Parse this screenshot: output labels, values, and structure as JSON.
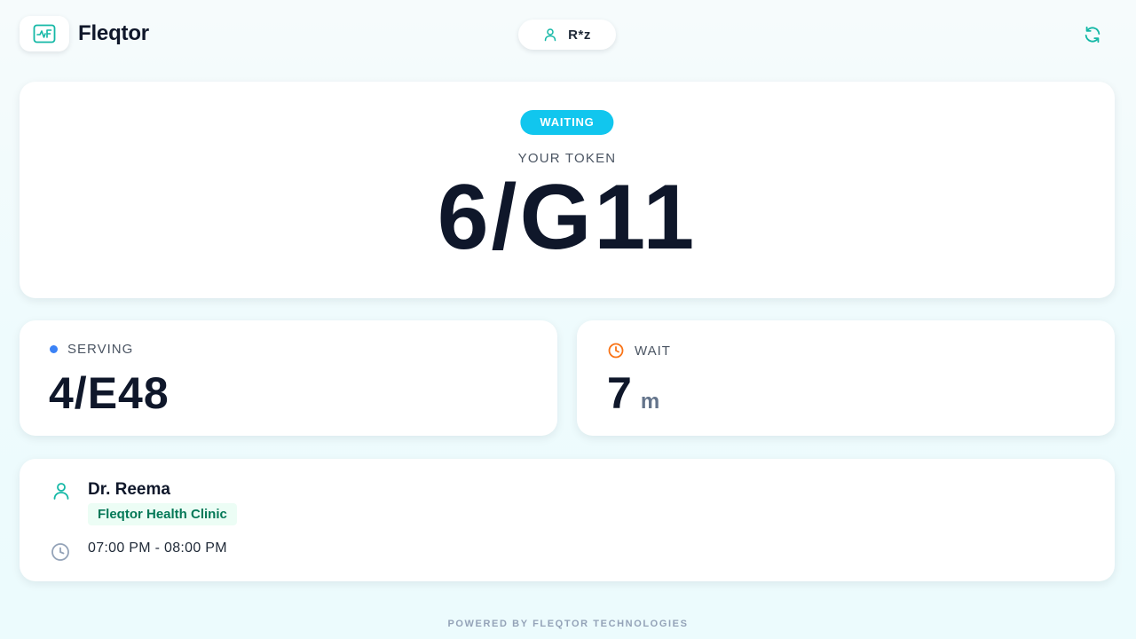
{
  "header": {
    "brand_name": "Fleqtor",
    "logo_icon": "heartbeat-monitor-icon",
    "user_icon": "user-icon",
    "user_name": "R*z",
    "refresh_icon": "refresh-icon"
  },
  "token": {
    "status": "WAITING",
    "label": "YOUR TOKEN",
    "value": "6/G11"
  },
  "serving": {
    "label": "SERVING",
    "value": "4/E48"
  },
  "wait": {
    "label": "WAIT",
    "value": "7",
    "unit": "m"
  },
  "doctor": {
    "name": "Dr. Reema",
    "clinic": "Fleqtor Health Clinic",
    "hours": "07:00 PM - 08:00 PM"
  },
  "footer": {
    "text": "POWERED BY FLEQTOR TECHNOLOGIES"
  },
  "colors": {
    "accent_teal": "#14b8a6",
    "status_cyan": "#11c6ee",
    "serving_blue": "#3b82f6",
    "wait_orange": "#f97316",
    "clinic_green": "#047857"
  }
}
